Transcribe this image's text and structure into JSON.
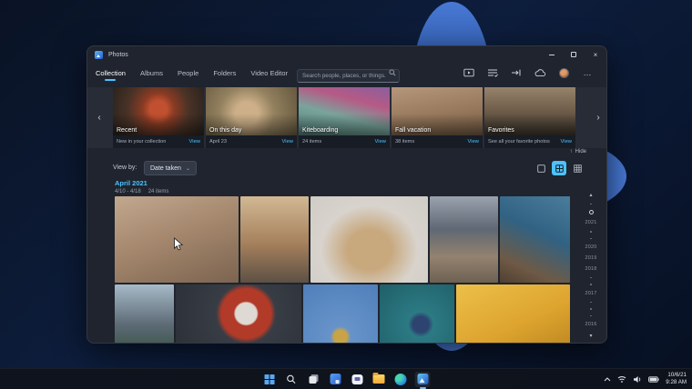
{
  "colors": {
    "accent": "#4cc2ff",
    "window_bg": "#1f242e",
    "carousel_bg": "#272c37",
    "taskbar_bg": "#0f131b"
  },
  "window": {
    "title": "Photos",
    "controls": {
      "minimize": "minimize",
      "maximize": "maximize",
      "close": "close"
    }
  },
  "nav": {
    "tabs": [
      {
        "label": "Collection",
        "selected": true
      },
      {
        "label": "Albums",
        "selected": false
      },
      {
        "label": "People",
        "selected": false
      },
      {
        "label": "Folders",
        "selected": false
      },
      {
        "label": "Video Editor",
        "selected": false
      }
    ],
    "search": {
      "placeholder": "Search people, places, or things..."
    },
    "toolbar_icons": [
      "slideshow",
      "multi-select",
      "import",
      "onedrive-cloud",
      "account-avatar",
      "see-more"
    ],
    "see_more_glyph": "…"
  },
  "carousel": {
    "cards": [
      {
        "title": "Recent",
        "subtitle": "New in your collection",
        "action": "View"
      },
      {
        "title": "On this day",
        "subtitle": "April 23",
        "action": "View"
      },
      {
        "title": "Kiteboarding",
        "subtitle": "24 items",
        "action": "View"
      },
      {
        "title": "Fall vacation",
        "subtitle": "38 items",
        "action": "View"
      },
      {
        "title": "Favorites",
        "subtitle": "See all your favorite photos",
        "action": "View"
      }
    ],
    "prev_glyph": "‹",
    "next_glyph": "›"
  },
  "view_bar": {
    "label": "View by:",
    "dropdown_value": "Date taken",
    "dropdown_chevron": "⌄",
    "hide_arrow": "↑",
    "hide_label": "Hide",
    "layout_icons": [
      "large-thumbnails",
      "medium-thumbnails",
      "small-thumbnails"
    ],
    "selected_layout": "medium-thumbnails"
  },
  "gallery": {
    "month": "April 2021",
    "date_range": "4/10 - 4/18",
    "item_count": "24 items",
    "timeline": {
      "up_glyph": "▴",
      "down_glyph": "▾",
      "years": [
        "2021",
        "2020",
        "2019",
        "2018",
        "2017",
        "2016"
      ]
    }
  },
  "photos": {
    "carousel": [
      {
        "label": "food-skillet-photo",
        "bg": "radial-gradient(circle at 50% 45%, #c0502f 0 16%, #8a3b24 30%, #4a3226 58%, #26221c 100%)"
      },
      {
        "label": "dog-on-rocks-photo",
        "bg": "radial-gradient(circle at 45% 55%, #cdb089 0 20%, #93815f 48%, #66583f 100%)"
      },
      {
        "label": "windsurf-sail-photo",
        "bg": "linear-gradient(195deg, #8a5f9e 0%, #b65a85 30%, #79a49c 58%, #527f78 100%)"
      },
      {
        "label": "rocky-landscape-photo",
        "bg": "linear-gradient(170deg, #b5977b 0%, #97785c 55%, #735a42 100%)"
      },
      {
        "label": "city-street-photo",
        "bg": "linear-gradient(180deg, #95836c 0%, #6e5c49 50%, #3b352c 100%)"
      }
    ],
    "grid_row1": [
      {
        "label": "desert-boulders-hiker-photo",
        "bg": "linear-gradient(160deg, #c2a88f 0%, #a3866c 48%, #7c6450 100%)"
      },
      {
        "label": "aerial-city-sunset-photo",
        "bg": "linear-gradient(180deg, #d2b894 0%, #a5805c 55%, #5d5044 100%)"
      },
      {
        "label": "poodle-on-chair-photo",
        "bg": "radial-gradient(ellipse at 50% 62%, #c8a87d 0 26%, #d8d3cc 58%, #cfccc6 100%)"
      },
      {
        "label": "rocky-shore-clouds-photo",
        "bg": "linear-gradient(180deg, #9aa2ae 0%, #5f6874 38%, #93826f 70%, #6e6152 100%)"
      },
      {
        "label": "cliff-ocean-waves-photo",
        "bg": "linear-gradient(205deg, #4a7c9b 0%, #316283 42%, #6e5a45 78%, #503f31 100%)"
      }
    ],
    "grid_row2": [
      {
        "label": "eiffel-tower-underside-photo",
        "bg": "linear-gradient(180deg, #a7bac8 0%, #5d6b76 55%, #35503e 100%)"
      },
      {
        "label": "overhead-lighthouse-person-photo",
        "bg": "radial-gradient(circle at 56% 40%, #ded9d2 0 13%, #b23a28 15% 30%, #383d45 36%, #2b3037 100%)"
      },
      {
        "label": "chain-swing-ride-photo",
        "bg": "radial-gradient(circle at 50% 72%, #c8a447 0 10%, #6793c9 16%, #4f7fba 100%)"
      },
      {
        "label": "swimmer-blue-water-photo",
        "bg": "radial-gradient(circle at 55% 55%, #2e4470 0 14%, #2c7a84 22%, #1f5f68 100%)"
      },
      {
        "label": "yellow-palace-photo",
        "bg": "linear-gradient(155deg, #ecc04a 0%, #dda42e 55%, #b8831f 100%)"
      }
    ]
  },
  "taskbar": {
    "items": [
      {
        "icon": "start"
      },
      {
        "icon": "search"
      },
      {
        "icon": "task-view"
      },
      {
        "icon": "widgets"
      },
      {
        "icon": "chat"
      },
      {
        "icon": "file-explorer"
      },
      {
        "icon": "edge"
      },
      {
        "icon": "photos",
        "active": true
      }
    ],
    "tray": {
      "icons": [
        "chevron-up",
        "wifi",
        "volume",
        "battery"
      ],
      "date": "10/6/21",
      "time": "9:28 AM"
    }
  }
}
